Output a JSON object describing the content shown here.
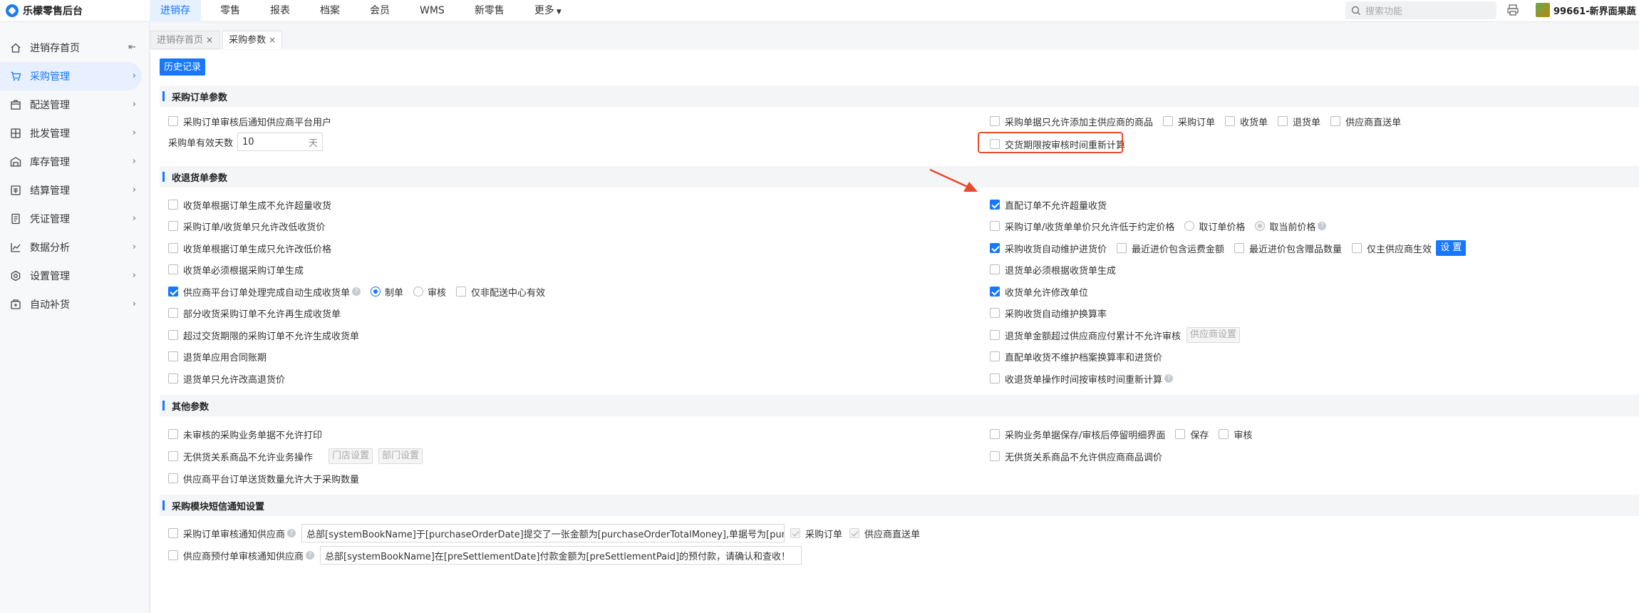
{
  "brand": {
    "name": "乐檬零售后台"
  },
  "topnav": [
    {
      "label": "进销存",
      "active": true
    },
    {
      "label": "零售"
    },
    {
      "label": "报表"
    },
    {
      "label": "档案"
    },
    {
      "label": "会员"
    },
    {
      "label": "WMS"
    },
    {
      "label": "新零售"
    },
    {
      "label": "更多"
    }
  ],
  "search": {
    "placeholder": "搜索功能"
  },
  "store": {
    "name": "99661-新界面果蔬"
  },
  "sidebar": [
    {
      "label": "进销存首页",
      "icon": "home-icon"
    },
    {
      "label": "采购管理",
      "icon": "cart-icon",
      "active": true
    },
    {
      "label": "配送管理",
      "icon": "box-icon"
    },
    {
      "label": "批发管理",
      "icon": "wholesale-icon"
    },
    {
      "label": "库存管理",
      "icon": "warehouse-icon"
    },
    {
      "label": "结算管理",
      "icon": "settlement-icon"
    },
    {
      "label": "凭证管理",
      "icon": "voucher-icon"
    },
    {
      "label": "数据分析",
      "icon": "chart-icon"
    },
    {
      "label": "设置管理",
      "icon": "gear-icon"
    },
    {
      "label": "自动补货",
      "icon": "replenish-icon"
    }
  ],
  "tabs": [
    {
      "label": "进销存首页"
    },
    {
      "label": "采购参数",
      "active": true
    }
  ],
  "history_button": "历史记录",
  "sections": {
    "purchase_order": "采购订单参数",
    "receipt": "收退货单参数",
    "other": "其他参数",
    "sms": "采购模块短信通知设置"
  },
  "po": {
    "notify_supplier": "采购订单审核后通知供应商平台用户",
    "valid_days_label": "采购单有效天数",
    "valid_days_value": "10",
    "valid_days_unit": "天",
    "main_supplier_only": "采购单据只允许添加主供应商的商品",
    "opt_po": "采购订单",
    "opt_receipt": "收货单",
    "opt_return": "退货单",
    "opt_direct": "供应商直送单",
    "recalc_delivery": "交货期限按审核时间重新计算"
  },
  "rc": {
    "l1": "收货单根据订单生成不允许超量收货",
    "l2": "采购订单/收货单只允许改低收货价",
    "l3": "收货单根据订单生成只允许改低价格",
    "l4": "收货单必须根据采购订单生成",
    "l5": "供应商平台订单处理完成自动生成收货单",
    "l5_r1": "制单",
    "l5_r2": "审核",
    "l5_c1": "仅非配送中心有效",
    "l6": "部分收货采购订单不允许再生成收货单",
    "l7": "超过交货期限的采购订单不允许生成收货单",
    "l8": "退货单应用合同账期",
    "l9": "退货单只允许改高退货价",
    "r1": "直配订单不允许超量收货",
    "r2": "采购订单/收货单单价只允许低于约定价格",
    "r2_r1": "取订单价格",
    "r2_r2": "取当前价格",
    "r3": "采购收货自动维护进货价",
    "r3_c1": "最近进价包含运费金额",
    "r3_c2": "最近进价包含赠品数量",
    "r3_c3": "仅主供应商生效",
    "r3_btn": "设 置",
    "r4": "退货单必须根据收货单生成",
    "r5": "收货单允许修改单位",
    "r6": "采购收货自动维护换算率",
    "r7": "退货单金额超过供应商应付累计不允许审核",
    "r7_btn": "供应商设置",
    "r8": "直配单收货不维护档案换算率和进货价",
    "r9": "收退货单操作时间按审核时间重新计算"
  },
  "other": {
    "l1": "未审核的采购业务单据不允许打印",
    "l2": "无供货关系商品不允许业务操作",
    "l2_btn1": "门店设置",
    "l2_btn2": "部门设置",
    "l3": "供应商平台订单送货数量允许大于采购数量",
    "r1": "采购业务单据保存/审核后停留明细界面",
    "r1_c1": "保存",
    "r1_c2": "审核",
    "r2": "无供货关系商品不允许供应商商品调价"
  },
  "sms": {
    "l1": "采购订单审核通知供应商",
    "l1_text": "总部[systemBookName]于[purchaseOrderDate]提交了一张金额为[purchaseOrderTotalMoney],单据号为[purc",
    "l1_c1": "采购订单",
    "l1_c2": "供应商直送单",
    "l2": "供应商预付单审核通知供应商",
    "l2_text": "总部[systemBookName]在[preSettlementDate]付款金额为[preSettlementPaid]的预付款，请确认和查收！"
  }
}
